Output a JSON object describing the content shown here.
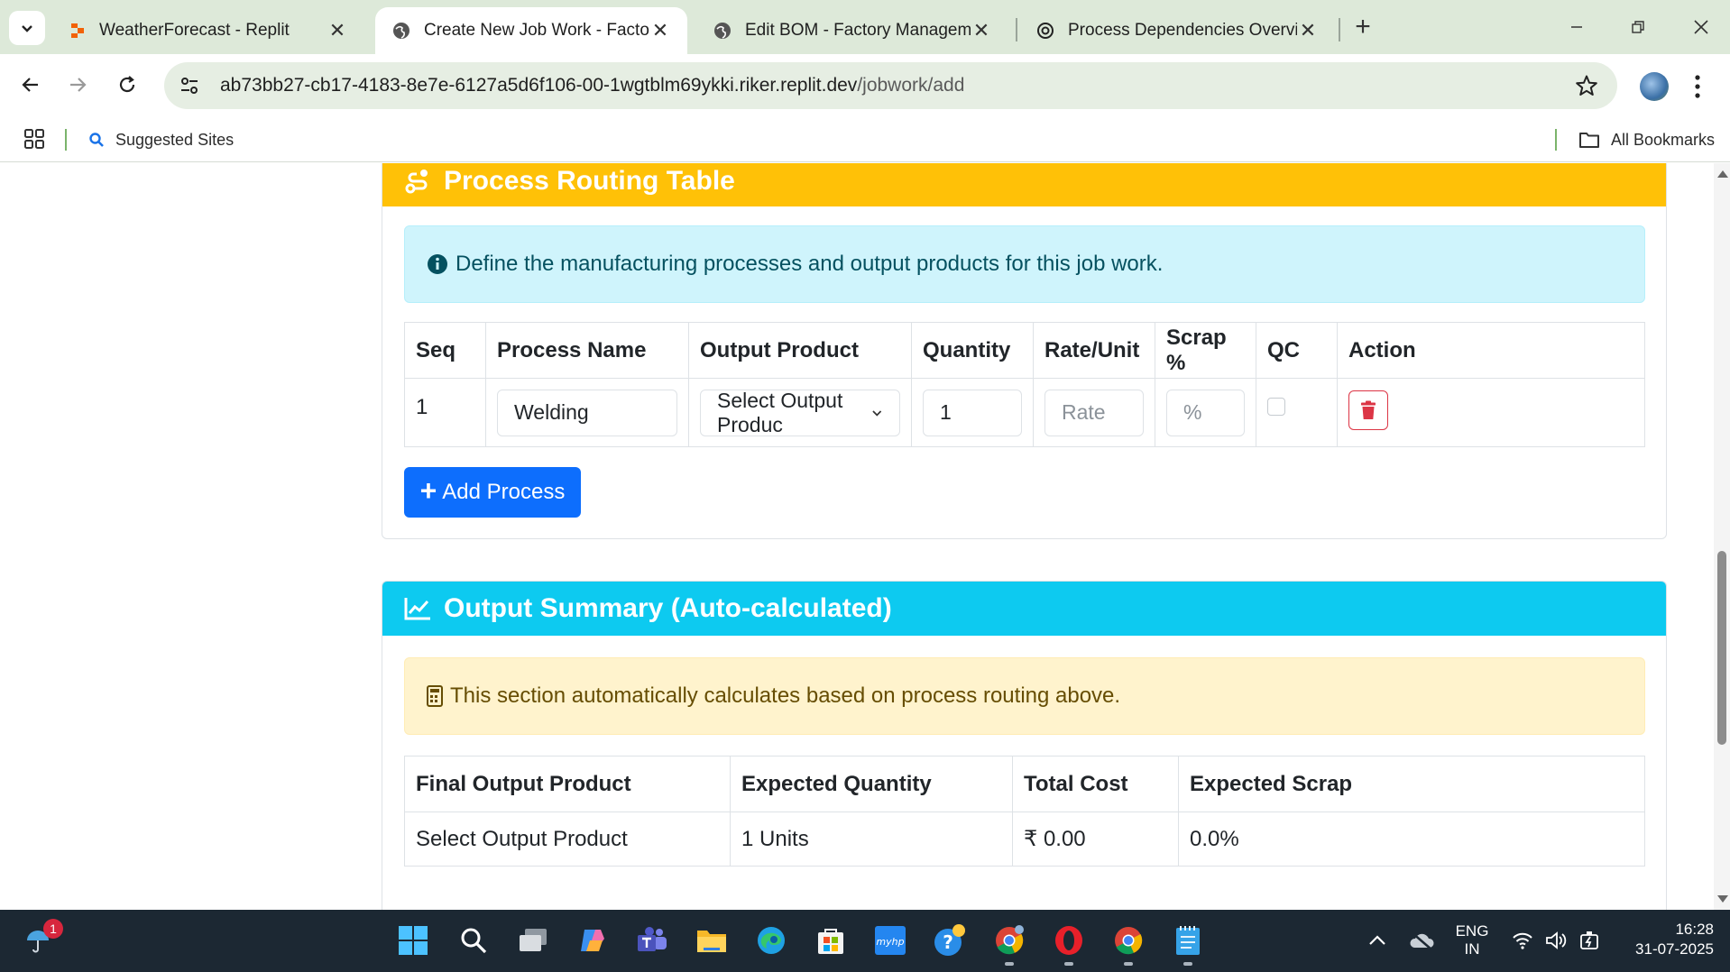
{
  "browser": {
    "tabs": [
      {
        "title": "WeatherForecast - Replit",
        "icon": "replit-icon",
        "active": false
      },
      {
        "title": "Create New Job Work - Factory",
        "icon": "globe-icon",
        "active": true
      },
      {
        "title": "Edit BOM - Factory Managemer",
        "icon": "globe-icon",
        "active": false
      },
      {
        "title": "Process Dependencies Overview",
        "icon": "chatgpt-icon",
        "active": false
      }
    ],
    "url_host": "ab73bb27-cb17-4183-8e7e-6127a5d6f106-00-1wgtblm69ykki.riker.replit.dev",
    "url_path": "/jobwork/add",
    "bookmarks": {
      "suggested_sites": "Suggested Sites",
      "all_bookmarks": "All Bookmarks"
    }
  },
  "routing": {
    "title": "Process Routing Table",
    "info": "Define the manufacturing processes and output products for this job work.",
    "columns": [
      "Seq",
      "Process Name",
      "Output Product",
      "Quantity",
      "Rate/Unit",
      "Scrap %",
      "QC",
      "Action"
    ],
    "rows": [
      {
        "seq": "1",
        "process_name": "Welding",
        "output_product": "Select Output Produc",
        "quantity": "1",
        "rate_placeholder": "Rate",
        "scrap_placeholder": "%",
        "qc_checked": false
      }
    ],
    "add_button": "Add Process"
  },
  "summary": {
    "title": "Output Summary (Auto-calculated)",
    "note": "This section automatically calculates based on process routing above.",
    "columns": [
      "Final Output Product",
      "Expected Quantity",
      "Total Cost",
      "Expected Scrap"
    ],
    "row": {
      "product": "Select Output Product",
      "quantity": "1 Units",
      "cost": "₹ 0.00",
      "scrap": "0.0%"
    }
  },
  "taskbar": {
    "weather_badge": "1",
    "lang_1": "ENG",
    "lang_2": "IN",
    "time": "16:28",
    "date": "31-07-2025"
  },
  "colors": {
    "warning_header": "#ffc107",
    "info_header": "#0dcaf0",
    "primary_button": "#0d6efd",
    "danger": "#dc3545"
  }
}
